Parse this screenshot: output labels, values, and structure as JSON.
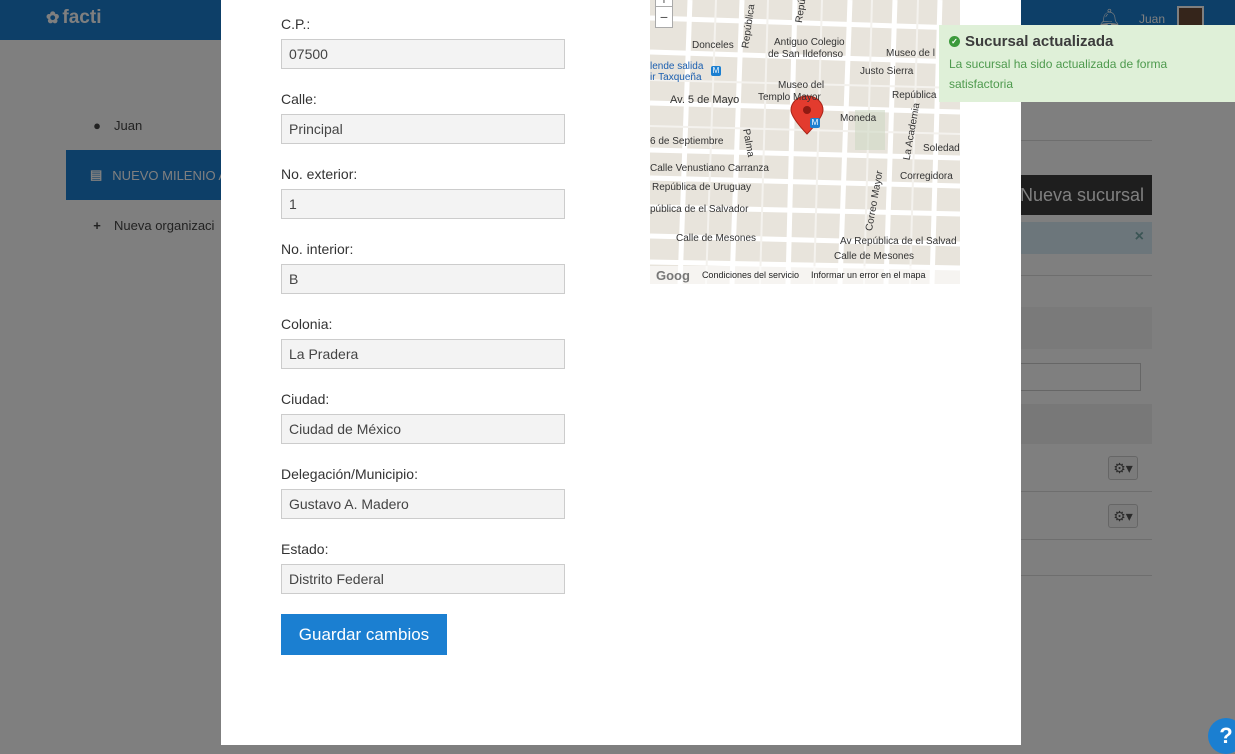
{
  "app": {
    "logo": "facti",
    "user": "Juan"
  },
  "sidebar": {
    "items": [
      {
        "label": "Juan",
        "icon": "user-icon"
      },
      {
        "label": "NUEVO MILENIO A",
        "icon": "building-icon"
      },
      {
        "label": "Nueva organizaci",
        "icon": "plus-icon"
      }
    ]
  },
  "background": {
    "new_branch_button": "Nueva sucursal"
  },
  "form": {
    "fields": [
      {
        "label": "C.P.:",
        "value": "07500"
      },
      {
        "label": "Calle:",
        "value": "Principal"
      },
      {
        "label": "No. exterior:",
        "value": "1"
      },
      {
        "label": "No. interior:",
        "value": "B"
      },
      {
        "label": "Colonia:",
        "value": "La Pradera"
      },
      {
        "label": "Ciudad:",
        "value": "Ciudad de México"
      },
      {
        "label": "Delegación/Municipio:",
        "value": "Gustavo A. Madero"
      },
      {
        "label": "Estado:",
        "value": "Distrito Federal"
      }
    ],
    "save_label": "Guardar cambios"
  },
  "map": {
    "labels": {
      "donceles": "Donceles",
      "antiguo": "Antiguo Colegio",
      "san_ildefonso": "de San Ildefonso",
      "museo_de": "Museo de l",
      "justo_sierra": "Justo Sierra",
      "salida": "lende salida",
      "taxquena": "ir Taxqueña",
      "museo_del": "Museo del",
      "templo": "Templo Mayor",
      "av5": "Av. 5 de Mayo",
      "republica_top": "República",
      "moneda": "Moneda",
      "septiembre": "6 de Septiembre",
      "soledad": "Soledad",
      "carranza": "Calle Venustiano Carranza",
      "corregidora": "Corregidora",
      "uruguay": "República de Uruguay",
      "salvador_left": "pública de el Salvador",
      "mesones_left": "Calle de Mesones",
      "salvador_right": "Av República de el Salvad",
      "mesones_right": "Calle de Mesones",
      "palma": "Palma",
      "academia": "La Academia",
      "correo": "Correo Mayor",
      "rep_vert1": "República",
      "rep_vert2": "Repú"
    },
    "zoom_in": "+",
    "zoom_out": "−",
    "google": "Goog",
    "terms": "Condiciones del servicio",
    "report": "Informar un error en el mapa"
  },
  "toast": {
    "title": "Sucursal actualizada",
    "message": "La sucursal ha sido actualizada de forma satisfactoria"
  },
  "help": "?"
}
